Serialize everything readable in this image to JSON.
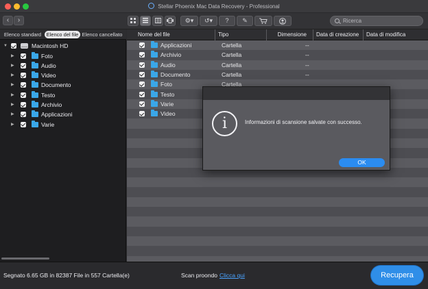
{
  "window": {
    "title": "Stellar Phoenix Mac Data Recovery - Professional"
  },
  "toolbar": {
    "back_icon": "chevron-left-icon",
    "forward_icon": "chevron-right-icon",
    "view_buttons": [
      "grid-view-icon",
      "list-view-icon",
      "column-view-icon",
      "coverflow-view-icon"
    ],
    "tool_buttons": [
      "gear-icon",
      "history-icon",
      "help-icon",
      "registration-icon",
      "cart-icon",
      "user-icon"
    ],
    "search_placeholder": "Ricerca"
  },
  "left_panel": {
    "tabs": [
      "Elenco standard",
      "Elenco del file",
      "Elenco cancellato"
    ],
    "selected_tab": "Elenco del file",
    "root": "Macintosh HD",
    "items": [
      "Foto",
      "Audio",
      "Video",
      "Documento",
      "Testo",
      "Archivio",
      "Applicazioni",
      "Varie"
    ]
  },
  "table": {
    "columns": [
      "Nome del file",
      "Tipo",
      "Dimensione",
      "Data di creazione",
      "Data di modifica"
    ],
    "rows": [
      {
        "name": "Applicazioni",
        "type": "Cartella",
        "size": "--"
      },
      {
        "name": "Archivio",
        "type": "Cartella",
        "size": "--"
      },
      {
        "name": "Audio",
        "type": "Cartella",
        "size": "--"
      },
      {
        "name": "Documento",
        "type": "Cartella",
        "size": "--"
      },
      {
        "name": "Foto",
        "type": "Cartella",
        "size": ""
      },
      {
        "name": "Testo",
        "type": "",
        "size": ""
      },
      {
        "name": "Varie",
        "type": "",
        "size": ""
      },
      {
        "name": "Video",
        "type": "",
        "size": ""
      }
    ]
  },
  "dialog": {
    "message": "Informazioni di scansione salvate con successo.",
    "ok_label": "OK"
  },
  "status": {
    "info": "Segnato 6.65 GB in 82387 File in 557 Cartella(e)",
    "scan_label": "Scan proondo",
    "scan_link": "Clicca qui",
    "recover_label": "Recupera"
  },
  "colors": {
    "accent": "#2f8ee8",
    "folder": "#3aa7e8",
    "link": "#4aa3ff"
  }
}
